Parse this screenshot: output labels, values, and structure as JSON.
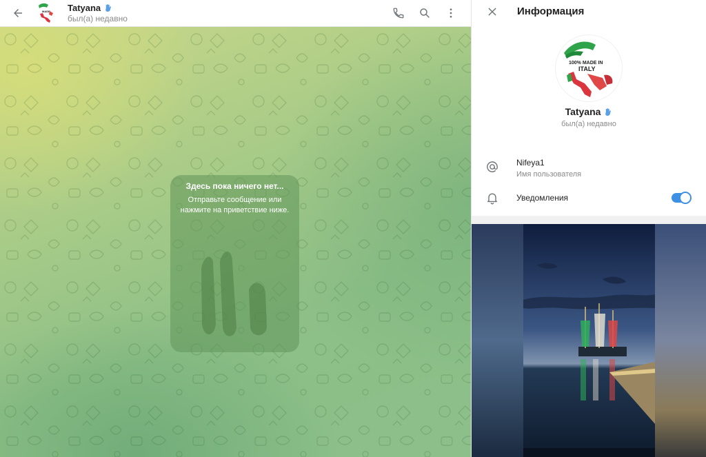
{
  "chat": {
    "name": "Tatyana",
    "status": "был(а) недавно",
    "empty_title": "Здесь пока ничего нет...",
    "empty_text": "Отправьте сообщение или нажмите на приветствие ниже."
  },
  "info": {
    "title": "Информация",
    "name": "Tatyana",
    "status": "был(а) недавно",
    "avatar_text": "100% MADE IN ITALY",
    "username": "Nifeya1",
    "username_label": "Имя пользователя",
    "notifications_label": "Уведомления",
    "notifications_on": true
  },
  "icons": [
    "back-arrow-icon",
    "wave-icon",
    "phone-icon",
    "search-icon",
    "more-vertical-icon",
    "close-icon",
    "at-icon",
    "bell-icon"
  ],
  "colors": {
    "accent": "#3d90e3",
    "wallpaper_green": "#8dbf87",
    "wallpaper_yellow": "#d8de78"
  }
}
